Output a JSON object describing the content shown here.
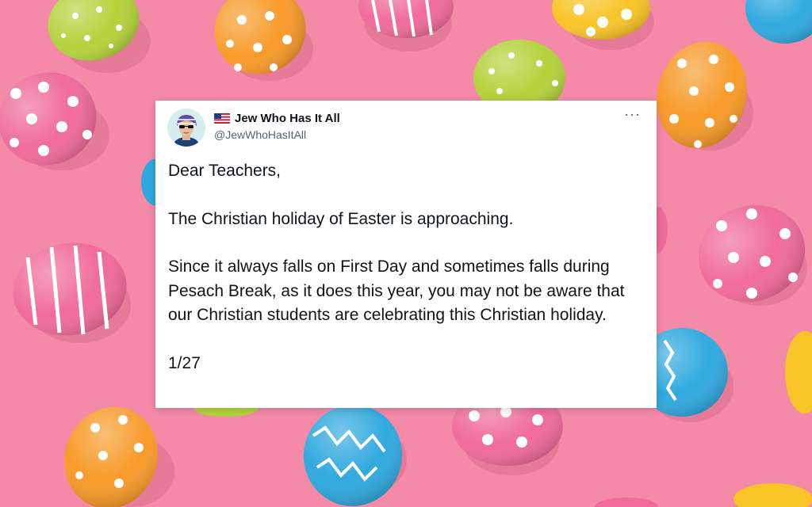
{
  "background": {
    "description_icon": "easter-eggs-pattern",
    "base_color": "#f48aa8"
  },
  "tweet": {
    "author_name": "Jew Who Has It All",
    "handle": "@JewWhoHasItAll",
    "flag_icon": "us-flag-icon",
    "more_label": "···",
    "paragraphs": [
      "Dear Teachers,",
      "The Christian holiday of Easter is approaching.",
      "Since it always falls on First Day and sometimes falls during Pesach Break, as it does this year, you may not be aware that our Christian students are celebrating this Christian holiday."
    ],
    "counter": "1/27"
  }
}
